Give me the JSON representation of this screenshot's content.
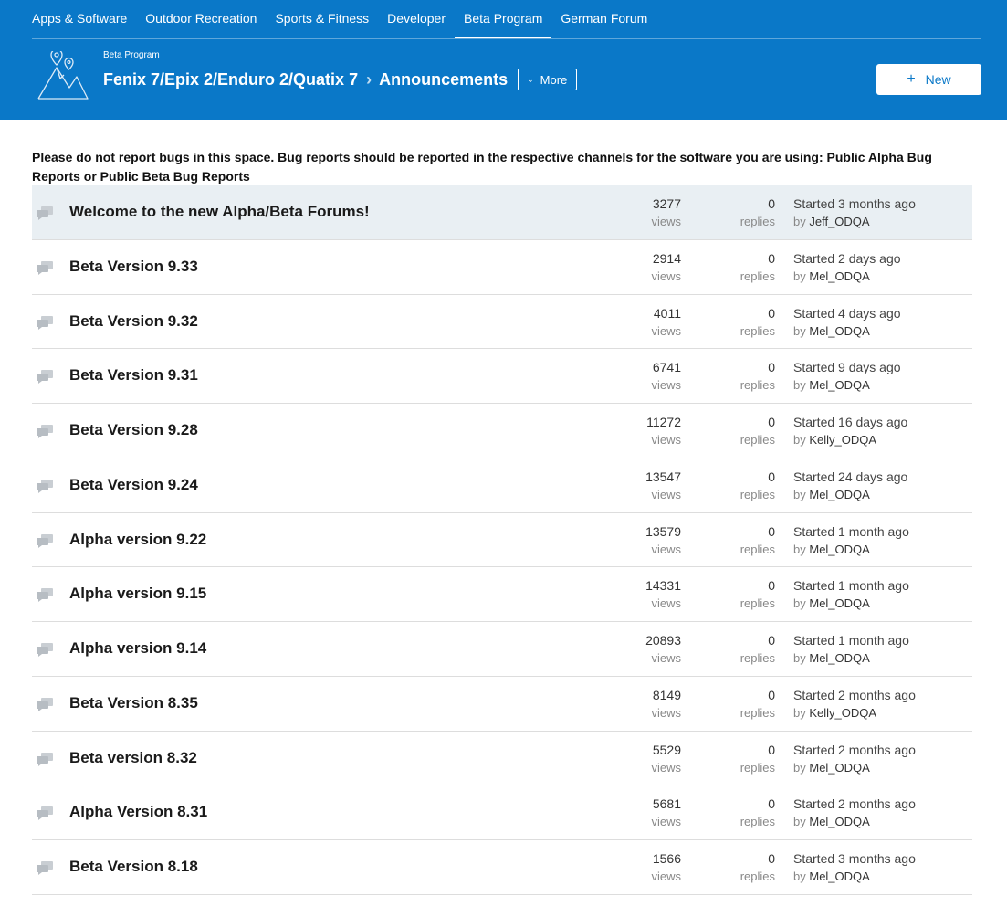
{
  "nav": {
    "items": [
      {
        "label": "Apps & Software",
        "active": false
      },
      {
        "label": "Outdoor Recreation",
        "active": false
      },
      {
        "label": "Sports & Fitness",
        "active": false
      },
      {
        "label": "Developer",
        "active": false
      },
      {
        "label": "Beta Program",
        "active": true
      },
      {
        "label": "German Forum",
        "active": false
      }
    ]
  },
  "header": {
    "parent_label": "Beta Program",
    "title": "Fenix 7/Epix 2/Enduro 2/Quatix 7",
    "subtitle": "Announcements",
    "more_label": "More",
    "new_label": "New",
    "logo_icon": "mountain-map-pin-icon",
    "background_color": "#0a78c8"
  },
  "notice": "Please do not report bugs in this space. Bug reports should be reported in the respective channels for the software you are using: Public Alpha Bug Reports or Public Beta Bug Reports",
  "labels": {
    "views": "views",
    "replies": "replies",
    "by": "by"
  },
  "topics": [
    {
      "title": "Welcome to the new Alpha/Beta Forums!",
      "views": "3277",
      "replies": "0",
      "started": "Started 3 months ago",
      "author": "Jeff_ODQA",
      "highlighted": true
    },
    {
      "title": "Beta Version 9.33",
      "views": "2914",
      "replies": "0",
      "started": "Started 2 days ago",
      "author": "Mel_ODQA",
      "highlighted": false
    },
    {
      "title": "Beta Version 9.32",
      "views": "4011",
      "replies": "0",
      "started": "Started 4 days ago",
      "author": "Mel_ODQA",
      "highlighted": false
    },
    {
      "title": "Beta Version 9.31",
      "views": "6741",
      "replies": "0",
      "started": "Started 9 days ago",
      "author": "Mel_ODQA",
      "highlighted": false
    },
    {
      "title": "Beta Version 9.28",
      "views": "11272",
      "replies": "0",
      "started": "Started 16 days ago",
      "author": "Kelly_ODQA",
      "highlighted": false
    },
    {
      "title": "Beta Version 9.24",
      "views": "13547",
      "replies": "0",
      "started": "Started 24 days ago",
      "author": "Mel_ODQA",
      "highlighted": false
    },
    {
      "title": "Alpha version 9.22",
      "views": "13579",
      "replies": "0",
      "started": "Started 1 month ago",
      "author": "Mel_ODQA",
      "highlighted": false
    },
    {
      "title": "Alpha version 9.15",
      "views": "14331",
      "replies": "0",
      "started": "Started 1 month ago",
      "author": "Mel_ODQA",
      "highlighted": false
    },
    {
      "title": "Alpha version 9.14",
      "views": "20893",
      "replies": "0",
      "started": "Started 1 month ago",
      "author": "Mel_ODQA",
      "highlighted": false
    },
    {
      "title": "Beta Version 8.35",
      "views": "8149",
      "replies": "0",
      "started": "Started 2 months ago",
      "author": "Kelly_ODQA",
      "highlighted": false
    },
    {
      "title": "Beta version 8.32",
      "views": "5529",
      "replies": "0",
      "started": "Started 2 months ago",
      "author": "Mel_ODQA",
      "highlighted": false
    },
    {
      "title": "Alpha Version 8.31",
      "views": "5681",
      "replies": "0",
      "started": "Started 2 months ago",
      "author": "Mel_ODQA",
      "highlighted": false
    },
    {
      "title": "Beta Version 8.18",
      "views": "1566",
      "replies": "0",
      "started": "Started 3 months ago",
      "author": "Mel_ODQA",
      "highlighted": false
    }
  ],
  "topic_icon": "discussion-bubbles-icon"
}
